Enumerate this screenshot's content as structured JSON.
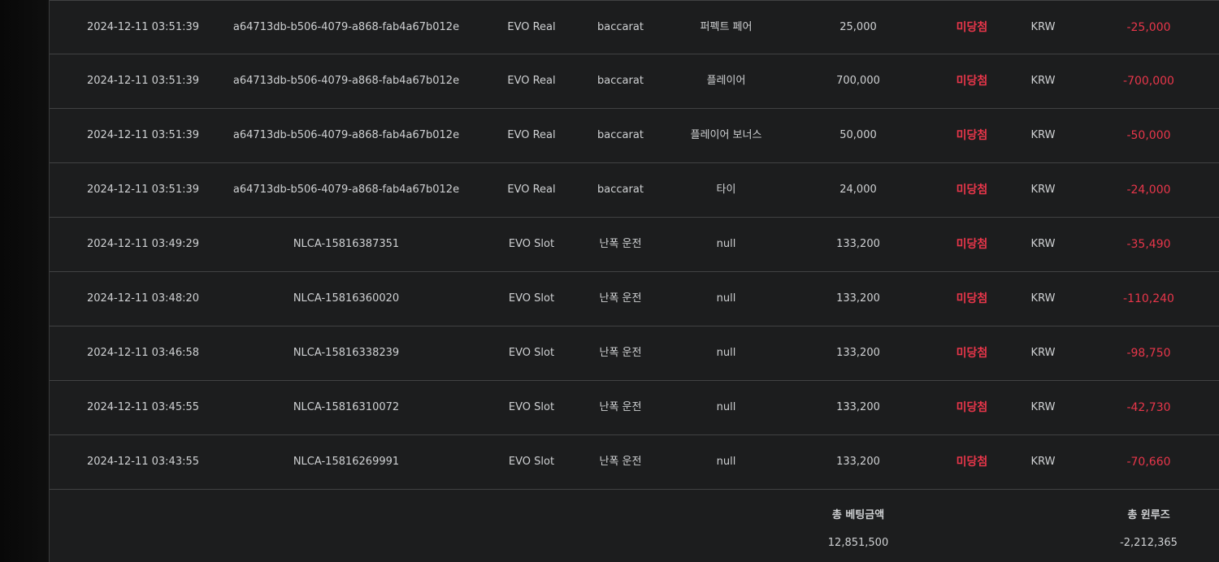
{
  "rows": [
    {
      "time": "2024-12-11 03:51:39",
      "id": "a64713db-b506-4079-a868-fab4a67b012e",
      "vendor": "EVO Real",
      "game": "baccarat",
      "bet_type": "퍼펙트 페어",
      "amount": "25,000",
      "result": "미당첨",
      "currency": "KRW",
      "win_loss": "-25,000"
    },
    {
      "time": "2024-12-11 03:51:39",
      "id": "a64713db-b506-4079-a868-fab4a67b012e",
      "vendor": "EVO Real",
      "game": "baccarat",
      "bet_type": "플레이어",
      "amount": "700,000",
      "result": "미당첨",
      "currency": "KRW",
      "win_loss": "-700,000"
    },
    {
      "time": "2024-12-11 03:51:39",
      "id": "a64713db-b506-4079-a868-fab4a67b012e",
      "vendor": "EVO Real",
      "game": "baccarat",
      "bet_type": "플레이어 보너스",
      "amount": "50,000",
      "result": "미당첨",
      "currency": "KRW",
      "win_loss": "-50,000"
    },
    {
      "time": "2024-12-11 03:51:39",
      "id": "a64713db-b506-4079-a868-fab4a67b012e",
      "vendor": "EVO Real",
      "game": "baccarat",
      "bet_type": "타이",
      "amount": "24,000",
      "result": "미당첨",
      "currency": "KRW",
      "win_loss": "-24,000"
    },
    {
      "time": "2024-12-11 03:49:29",
      "id": "NLCA-15816387351",
      "vendor": "EVO Slot",
      "game": "난폭 운전",
      "bet_type": "null",
      "amount": "133,200",
      "result": "미당첨",
      "currency": "KRW",
      "win_loss": "-35,490"
    },
    {
      "time": "2024-12-11 03:48:20",
      "id": "NLCA-15816360020",
      "vendor": "EVO Slot",
      "game": "난폭 운전",
      "bet_type": "null",
      "amount": "133,200",
      "result": "미당첨",
      "currency": "KRW",
      "win_loss": "-110,240"
    },
    {
      "time": "2024-12-11 03:46:58",
      "id": "NLCA-15816338239",
      "vendor": "EVO Slot",
      "game": "난폭 운전",
      "bet_type": "null",
      "amount": "133,200",
      "result": "미당첨",
      "currency": "KRW",
      "win_loss": "-98,750"
    },
    {
      "time": "2024-12-11 03:45:55",
      "id": "NLCA-15816310072",
      "vendor": "EVO Slot",
      "game": "난폭 운전",
      "bet_type": "null",
      "amount": "133,200",
      "result": "미당첨",
      "currency": "KRW",
      "win_loss": "-42,730"
    },
    {
      "time": "2024-12-11 03:43:55",
      "id": "NLCA-15816269991",
      "vendor": "EVO Slot",
      "game": "난폭 운전",
      "bet_type": "null",
      "amount": "133,200",
      "result": "미당첨",
      "currency": "KRW",
      "win_loss": "-70,660"
    }
  ],
  "summary": {
    "total_bet_label": "총 베팅금액",
    "total_bet_value": "12,851,500",
    "total_winloss_label": "총 윈루즈",
    "total_winloss_value": "-2,212,365"
  },
  "colors": {
    "loss_red": "#e8364a",
    "row_bg": "#1c1d1e",
    "divider": "#414243",
    "text": "#cfd1d3"
  }
}
